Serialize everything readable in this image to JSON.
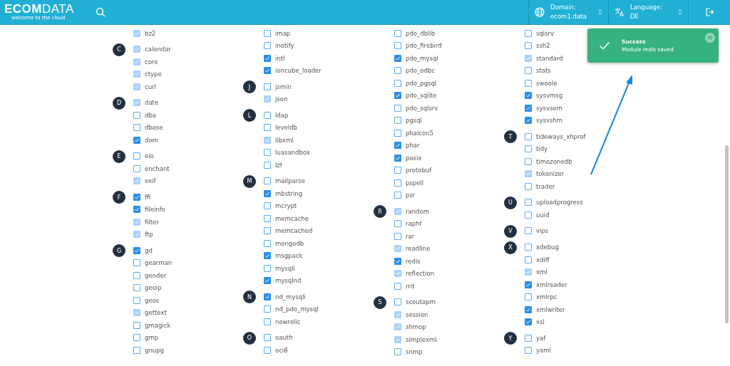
{
  "header": {
    "logo": "**ECOM**DATA",
    "tagline": "welcome to the cloud",
    "domain": {
      "label": "Domain:",
      "value": "ecom1.data"
    },
    "language": {
      "label": "Language:",
      "value": "DE"
    }
  },
  "columns": [
    {
      "groups": [
        {
          "items": [
            {
              "name": "bz2",
              "checked": true,
              "disabled": true
            }
          ]
        },
        {
          "letter": "C",
          "items": [
            {
              "name": "calendar",
              "checked": true,
              "disabled": true
            },
            {
              "name": "core",
              "checked": true,
              "disabled": true
            },
            {
              "name": "ctype",
              "checked": true,
              "disabled": true
            },
            {
              "name": "curl",
              "checked": true,
              "disabled": true
            }
          ]
        },
        {
          "letter": "D",
          "items": [
            {
              "name": "date",
              "checked": true,
              "disabled": true
            },
            {
              "name": "dba",
              "checked": false,
              "disabled": false
            },
            {
              "name": "dbase",
              "checked": false,
              "disabled": false
            },
            {
              "name": "dom",
              "checked": true,
              "disabled": false
            }
          ]
        },
        {
          "letter": "E",
          "items": [
            {
              "name": "eio",
              "checked": false,
              "disabled": false
            },
            {
              "name": "enchant",
              "checked": false,
              "disabled": false
            },
            {
              "name": "exif",
              "checked": true,
              "disabled": true
            }
          ]
        },
        {
          "letter": "F",
          "items": [
            {
              "name": "ffi",
              "checked": true,
              "disabled": false
            },
            {
              "name": "fileinfo",
              "checked": true,
              "disabled": false
            },
            {
              "name": "filter",
              "checked": true,
              "disabled": true
            },
            {
              "name": "ftp",
              "checked": true,
              "disabled": true
            }
          ]
        },
        {
          "letter": "G",
          "items": [
            {
              "name": "gd",
              "checked": true,
              "disabled": false
            },
            {
              "name": "gearman",
              "checked": false,
              "disabled": false
            },
            {
              "name": "gender",
              "checked": false,
              "disabled": false
            },
            {
              "name": "geoip",
              "checked": false,
              "disabled": false
            },
            {
              "name": "geos",
              "checked": false,
              "disabled": false
            },
            {
              "name": "gettext",
              "checked": true,
              "disabled": true
            },
            {
              "name": "gmagick",
              "checked": false,
              "disabled": false
            },
            {
              "name": "gmp",
              "checked": false,
              "disabled": false
            },
            {
              "name": "gnupg",
              "checked": false,
              "disabled": false
            }
          ]
        }
      ]
    },
    {
      "groups": [
        {
          "items": [
            {
              "name": "imap",
              "checked": false,
              "disabled": false
            },
            {
              "name": "inotify",
              "checked": false,
              "disabled": false
            },
            {
              "name": "intl",
              "checked": true,
              "disabled": false
            },
            {
              "name": "ioncube_loader",
              "checked": true,
              "disabled": false
            }
          ]
        },
        {
          "letter": "J",
          "items": [
            {
              "name": "jsmin",
              "checked": false,
              "disabled": false
            },
            {
              "name": "json",
              "checked": true,
              "disabled": true
            }
          ]
        },
        {
          "letter": "L",
          "items": [
            {
              "name": "ldap",
              "checked": false,
              "disabled": false
            },
            {
              "name": "leveldb",
              "checked": false,
              "disabled": false
            },
            {
              "name": "libxml",
              "checked": true,
              "disabled": true
            },
            {
              "name": "luasandbox",
              "checked": false,
              "disabled": false
            },
            {
              "name": "lzf",
              "checked": false,
              "disabled": false
            }
          ]
        },
        {
          "letter": "M",
          "items": [
            {
              "name": "mailparse",
              "checked": false,
              "disabled": false
            },
            {
              "name": "mbstring",
              "checked": true,
              "disabled": false
            },
            {
              "name": "mcrypt",
              "checked": false,
              "disabled": false
            },
            {
              "name": "memcache",
              "checked": false,
              "disabled": false
            },
            {
              "name": "memcached",
              "checked": false,
              "disabled": false
            },
            {
              "name": "mongodb",
              "checked": false,
              "disabled": false
            },
            {
              "name": "msgpack",
              "checked": true,
              "disabled": false
            },
            {
              "name": "mysqli",
              "checked": false,
              "disabled": false
            },
            {
              "name": "mysqlnd",
              "checked": true,
              "disabled": false
            }
          ]
        },
        {
          "letter": "N",
          "items": [
            {
              "name": "nd_mysqli",
              "checked": true,
              "disabled": false
            },
            {
              "name": "nd_pdo_mysql",
              "checked": false,
              "disabled": false
            },
            {
              "name": "newrelic",
              "checked": false,
              "disabled": false
            }
          ]
        },
        {
          "letter": "O",
          "items": [
            {
              "name": "oauth",
              "checked": false,
              "disabled": false
            },
            {
              "name": "oci8",
              "checked": false,
              "disabled": false
            }
          ]
        }
      ]
    },
    {
      "groups": [
        {
          "items": [
            {
              "name": "pdo_dblib",
              "checked": false,
              "disabled": false
            },
            {
              "name": "pdo_firebird",
              "checked": false,
              "disabled": false
            },
            {
              "name": "pdo_mysql",
              "checked": true,
              "disabled": false
            },
            {
              "name": "pdo_odbc",
              "checked": false,
              "disabled": false
            },
            {
              "name": "pdo_pgsql",
              "checked": false,
              "disabled": false
            },
            {
              "name": "pdo_sqlite",
              "checked": true,
              "disabled": false
            },
            {
              "name": "pdo_sqlsrv",
              "checked": false,
              "disabled": false
            },
            {
              "name": "pgsql",
              "checked": false,
              "disabled": false
            },
            {
              "name": "phalcon5",
              "checked": false,
              "disabled": false
            },
            {
              "name": "phar",
              "checked": true,
              "disabled": false
            },
            {
              "name": "posix",
              "checked": true,
              "disabled": false
            },
            {
              "name": "protobuf",
              "checked": false,
              "disabled": false
            },
            {
              "name": "pspell",
              "checked": false,
              "disabled": false
            },
            {
              "name": "psr",
              "checked": false,
              "disabled": false
            }
          ]
        },
        {
          "letter": "R",
          "items": [
            {
              "name": "random",
              "checked": true,
              "disabled": true
            },
            {
              "name": "raphf",
              "checked": false,
              "disabled": false
            },
            {
              "name": "rar",
              "checked": false,
              "disabled": false
            },
            {
              "name": "readline",
              "checked": true,
              "disabled": true
            },
            {
              "name": "redis",
              "checked": true,
              "disabled": false
            },
            {
              "name": "reflection",
              "checked": true,
              "disabled": true
            },
            {
              "name": "rrd",
              "checked": false,
              "disabled": false
            }
          ]
        },
        {
          "letter": "S",
          "items": [
            {
              "name": "scoutapm",
              "checked": false,
              "disabled": false
            },
            {
              "name": "session",
              "checked": true,
              "disabled": true
            },
            {
              "name": "shmop",
              "checked": true,
              "disabled": true
            },
            {
              "name": "simplexml",
              "checked": true,
              "disabled": true
            },
            {
              "name": "snmp",
              "checked": false,
              "disabled": false
            }
          ]
        }
      ]
    },
    {
      "groups": [
        {
          "items": [
            {
              "name": "sqlsrv",
              "checked": false,
              "disabled": false
            },
            {
              "name": "ssh2",
              "checked": false,
              "disabled": false
            },
            {
              "name": "standard",
              "checked": true,
              "disabled": true
            },
            {
              "name": "stats",
              "checked": false,
              "disabled": false
            },
            {
              "name": "swoole",
              "checked": false,
              "disabled": false
            },
            {
              "name": "sysvmsg",
              "checked": true,
              "disabled": false
            },
            {
              "name": "sysvsem",
              "checked": true,
              "disabled": false
            },
            {
              "name": "sysvshm",
              "checked": true,
              "disabled": false
            }
          ]
        },
        {
          "letter": "T",
          "items": [
            {
              "name": "tideways_xhprof",
              "checked": false,
              "disabled": false
            },
            {
              "name": "tidy",
              "checked": false,
              "disabled": false
            },
            {
              "name": "timezonedb",
              "checked": false,
              "disabled": false
            },
            {
              "name": "tokenizer",
              "checked": true,
              "disabled": true
            },
            {
              "name": "trader",
              "checked": false,
              "disabled": false
            }
          ]
        },
        {
          "letter": "U",
          "items": [
            {
              "name": "uploadprogress",
              "checked": false,
              "disabled": false
            },
            {
              "name": "uuid",
              "checked": false,
              "disabled": false
            }
          ]
        },
        {
          "letter": "V",
          "items": [
            {
              "name": "vips",
              "checked": false,
              "disabled": false
            }
          ]
        },
        {
          "letter": "X",
          "items": [
            {
              "name": "xdebug",
              "checked": false,
              "disabled": false
            },
            {
              "name": "xdiff",
              "checked": false,
              "disabled": false
            },
            {
              "name": "xml",
              "checked": true,
              "disabled": true
            },
            {
              "name": "xmlreader",
              "checked": true,
              "disabled": false
            },
            {
              "name": "xmlrpc",
              "checked": false,
              "disabled": false
            },
            {
              "name": "xmlwriter",
              "checked": true,
              "disabled": false
            },
            {
              "name": "xsl",
              "checked": true,
              "disabled": false
            }
          ]
        },
        {
          "letter": "Y",
          "items": [
            {
              "name": "yaf",
              "checked": false,
              "disabled": false
            },
            {
              "name": "yaml",
              "checked": false,
              "disabled": false
            }
          ]
        }
      ]
    }
  ],
  "toast": {
    "title": "Success",
    "message": "Module redis saved"
  }
}
